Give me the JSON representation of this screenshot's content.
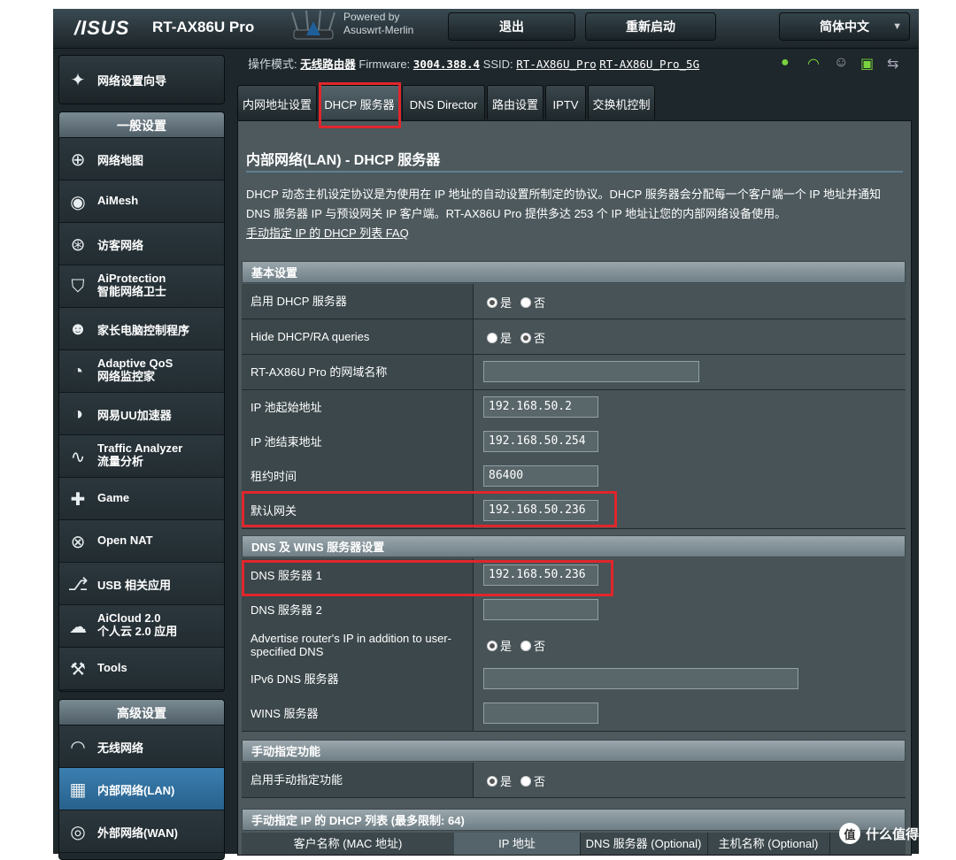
{
  "header": {
    "logo": "/ISUS",
    "model": "RT-AX86U Pro",
    "powered_line1": "Powered by",
    "powered_line2": "Asuswrt-Merlin",
    "logout": "退出",
    "reboot": "重新启动",
    "language": "简体中文"
  },
  "status": {
    "mode_label": "操作模式:",
    "mode_value": "无线路由器",
    "fw_label": "Firmware:",
    "fw_value": "3004.388.4",
    "ssid_label": "SSID:",
    "ssid_1": "RT-AX86U_Pro",
    "ssid_2": "RT-AX86U_Pro_5G",
    "icons": [
      "globe-icon",
      "wifi-icon",
      "users-icon",
      "devices-icon",
      "usb-icon"
    ]
  },
  "sidebar": {
    "wizard": "网络设置向导",
    "general_header": "一般设置",
    "general": [
      {
        "label": "网络地图",
        "icon": "network-map-icon"
      },
      {
        "label": "AiMesh",
        "icon": "aimesh-icon"
      },
      {
        "label": "访客网络",
        "icon": "guest-network-icon"
      },
      {
        "label": "AiProtection",
        "sub": "智能网络卫士",
        "icon": "shield-icon"
      },
      {
        "label": "家长电脑控制程序",
        "icon": "parental-control-icon"
      },
      {
        "label": "Adaptive QoS",
        "sub": "网络监控家",
        "icon": "gauge-icon"
      },
      {
        "label": "网易UU加速器",
        "icon": "speed-icon"
      },
      {
        "label": "Traffic Analyzer",
        "sub": "流量分析",
        "icon": "traffic-icon"
      },
      {
        "label": "Game",
        "icon": "gamepad-icon"
      },
      {
        "label": "Open NAT",
        "icon": "open-nat-icon"
      },
      {
        "label": "USB 相关应用",
        "icon": "usb-app-icon"
      },
      {
        "label": "AiCloud 2.0",
        "sub": "个人云 2.0 应用",
        "icon": "cloud-icon"
      },
      {
        "label": "Tools",
        "icon": "wrench-icon"
      }
    ],
    "advanced_header": "高级设置",
    "advanced": [
      {
        "label": "无线网络",
        "icon": "wireless-icon"
      },
      {
        "label": "内部网络(LAN)",
        "icon": "lan-icon"
      },
      {
        "label": "外部网络(WAN)",
        "icon": "wan-icon"
      }
    ]
  },
  "tabs": [
    "内网地址设置",
    "DHCP 服务器",
    "DNS Director",
    "路由设置",
    "IPTV",
    "交换机控制"
  ],
  "page": {
    "title": "内部网络(LAN) - DHCP 服务器",
    "desc1": "DHCP 动态主机设定协议是为使用在 IP 地址的自动设置所制定的协议。DHCP 服务器会分配每一个客户端一个 IP 地址并通知",
    "desc2": "DNS 服务器 IP 与预设网关 IP 客户端。RT-AX86U Pro 提供多达 253 个 IP 地址让您的内部网络设备使用。",
    "faq": "手动指定 IP 的 DHCP 列表 FAQ"
  },
  "basic": {
    "header": "基本设置",
    "enable_dhcp": "启用 DHCP 服务器",
    "hide_ra": "Hide DHCP/RA queries",
    "domain_name": "RT-AX86U Pro 的网域名称",
    "domain_value": "",
    "pool_start": "IP 池起始地址",
    "pool_start_value": "192.168.50.2",
    "pool_end": "IP 池结束地址",
    "pool_end_value": "192.168.50.254",
    "lease": "租约时间",
    "lease_value": "86400",
    "gateway": "默认网关",
    "gateway_value": "192.168.50.236"
  },
  "dns": {
    "header": "DNS 及 WINS 服务器设置",
    "dns1": "DNS 服务器 1",
    "dns1_value": "192.168.50.236",
    "dns2": "DNS 服务器 2",
    "dns2_value": "",
    "advertise": "Advertise router's IP in addition to user-specified DNS",
    "ipv6": "IPv6 DNS 服务器",
    "ipv6_value": "",
    "wins": "WINS 服务器",
    "wins_value": ""
  },
  "manual": {
    "header": "手动指定功能",
    "enable": "启用手动指定功能",
    "list_header": "手动指定 IP 的 DHCP 列表 (最多限制:  64)",
    "cols": [
      "客户名称 (MAC 地址)",
      "IP 地址",
      "DNS 服务器 (Optional)",
      "主机名称 (Optional)"
    ]
  },
  "radio": {
    "yes": "是",
    "no": "否"
  },
  "watermark": {
    "logo": "值",
    "text": "什么值得买"
  }
}
